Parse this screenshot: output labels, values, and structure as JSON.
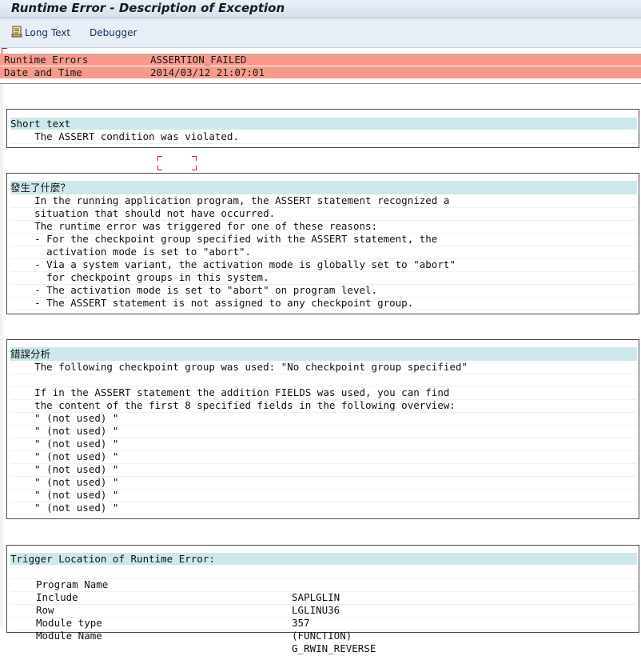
{
  "window": {
    "title": "Runtime Error - Description of Exception"
  },
  "toolbar": {
    "long_text": "Long Text",
    "debugger": "Debugger"
  },
  "error_header": {
    "runtime_errors_label": "Runtime Errors",
    "runtime_errors_value": "ASSERTION_FAILED",
    "date_label": "Date and Time",
    "date_value": "2014/03/12 21:07:01"
  },
  "short_text": {
    "heading": "Short text",
    "lines": [
      "    The ASSERT condition was violated."
    ]
  },
  "what_happened": {
    "heading": "發生了什麼？",
    "lines": [
      "    In the running application program, the ASSERT statement recognized a",
      "    situation that should not have occurred.",
      "    The runtime error was triggered for one of these reasons:",
      "    - For the checkpoint group specified with the ASSERT statement, the",
      "      activation mode is set to \"abort\".",
      "    - Via a system variant, the activation mode is globally set to \"abort\"",
      "      for checkpoint groups in this system.",
      "    - The activation mode is set to \"abort\" on program level.",
      "    - The ASSERT statement is not assigned to any checkpoint group."
    ]
  },
  "error_analysis": {
    "heading": "錯誤分析",
    "lines": [
      "    The following checkpoint group was used: \"No checkpoint group specified\"",
      "",
      "    If in the ASSERT statement the addition FIELDS was used, you can find",
      "    the content of the first 8 specified fields in the following overview:",
      "    \" (not used) \"",
      "    \" (not used) \"",
      "    \" (not used) \"",
      "    \" (not used) \"",
      "    \" (not used) \"",
      "    \" (not used) \"",
      "    \" (not used) \"",
      "    \" (not used) \""
    ]
  },
  "trigger_location": {
    "heading": "Trigger Location of Runtime Error:",
    "rows": [
      {
        "key": "Program Name",
        "value": "SAPLGLIN"
      },
      {
        "key": "Include",
        "value": "LGLINU36"
      },
      {
        "key": "Row",
        "value": "357"
      },
      {
        "key": "Module type",
        "value": "(FUNCTION)"
      },
      {
        "key": "Module Name",
        "value": "G_RWIN_REVERSE"
      }
    ]
  }
}
